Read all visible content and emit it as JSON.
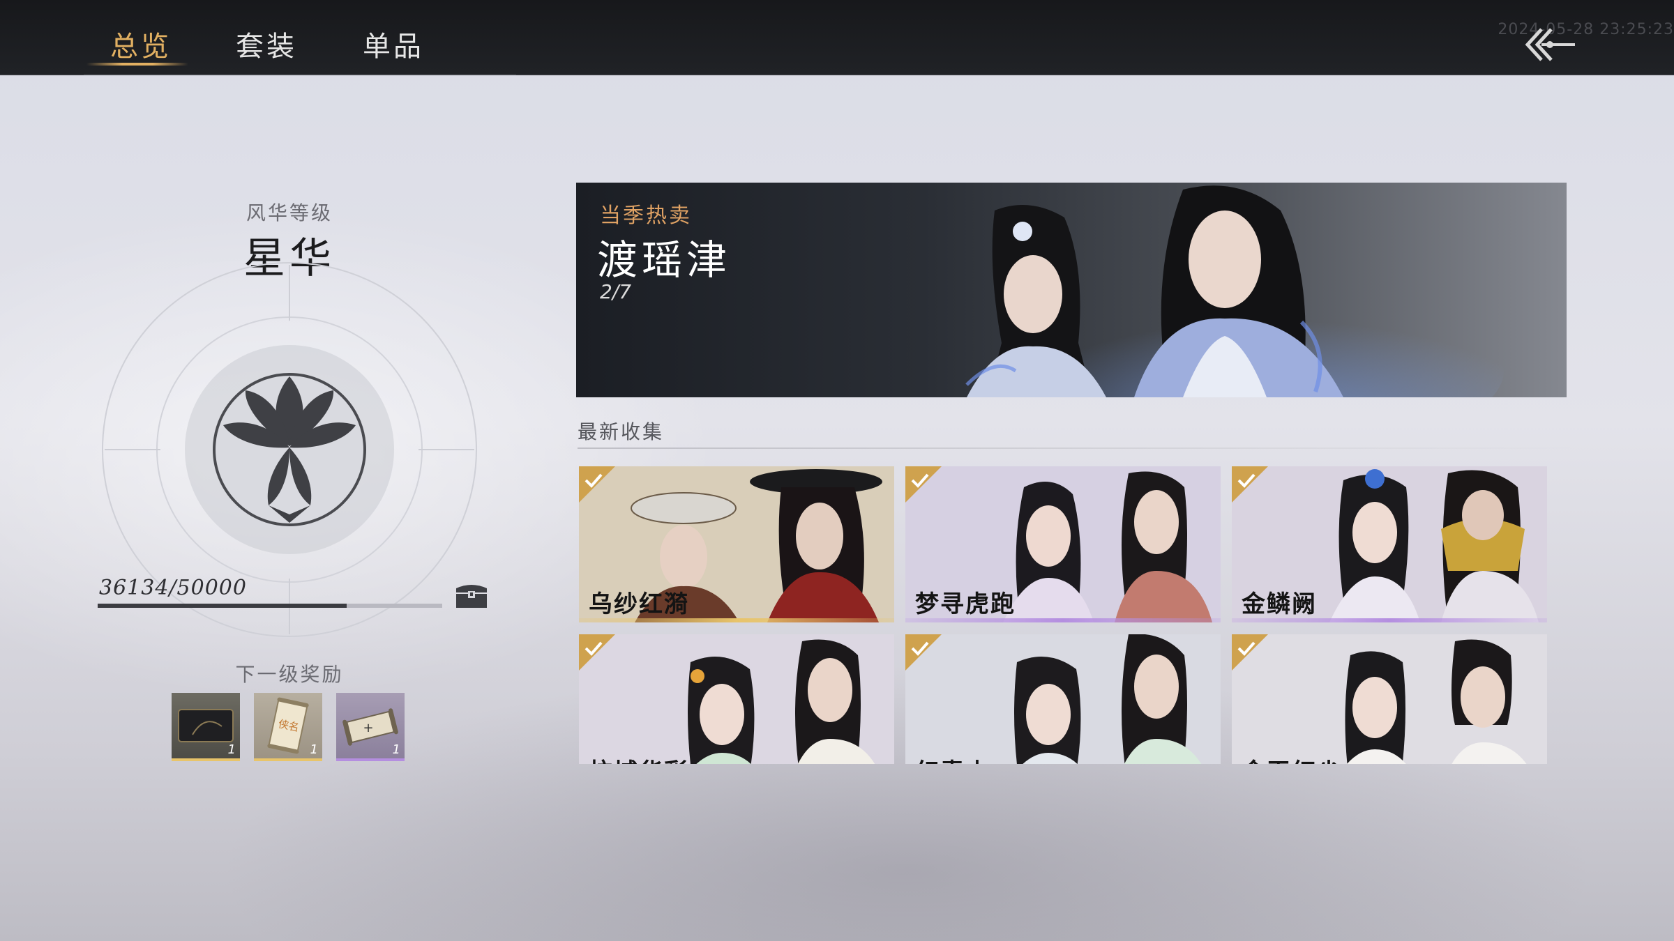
{
  "tabs": [
    {
      "label": "总览",
      "active": true
    },
    {
      "label": "套装",
      "active": false
    },
    {
      "label": "单品",
      "active": false
    }
  ],
  "timestamp": "2024-05-28 23:25:23",
  "level": {
    "caption": "风华等级",
    "name": "星华",
    "progress_text": "36134/50000",
    "progress_current": 36134,
    "progress_max": 50000
  },
  "rewards": {
    "caption": "下一级奖励",
    "items": [
      {
        "icon": "dark-card-icon",
        "count": "1",
        "rarity_color": "#e8c46a"
      },
      {
        "icon": "scroll-name-icon",
        "count": "1",
        "rarity_color": "#e8c46a",
        "scroll_text": "侠名"
      },
      {
        "icon": "scroll-plus-icon",
        "count": "1",
        "rarity_color": "#b48ee0"
      }
    ]
  },
  "banner": {
    "tag": "当季热卖",
    "title": "渡瑶津",
    "count": "2/7"
  },
  "latest": {
    "title": "最新收集",
    "cards": [
      {
        "name": "乌纱红漪",
        "collected": true,
        "tone": "gold"
      },
      {
        "name": "梦寻虎跑",
        "collected": true,
        "tone": "purple"
      },
      {
        "name": "金鳞阙",
        "collected": true,
        "tone": "purple"
      },
      {
        "name": "杭城华彩",
        "collected": true,
        "tone": "purple"
      },
      {
        "name": "幻青山",
        "collected": true,
        "tone": "purple"
      },
      {
        "name": "金玉红尘",
        "collected": true,
        "tone": "purple"
      }
    ]
  },
  "colors": {
    "accent_gold": "#e2b062",
    "tag_orange": "#e0a264",
    "rarity_gold": "#e8c46a",
    "rarity_purple": "#b48ee0"
  }
}
